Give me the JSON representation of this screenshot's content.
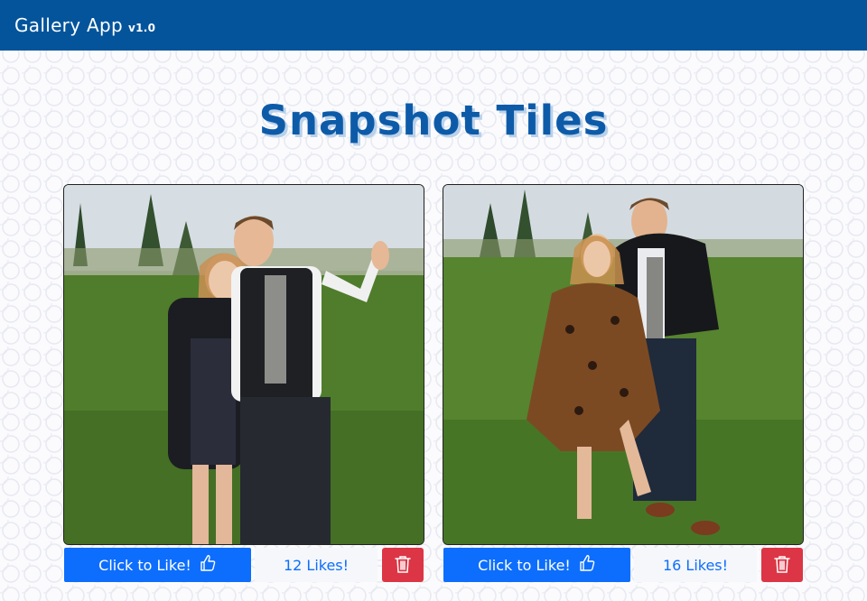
{
  "navbar": {
    "brand": "Gallery App",
    "version": "v1.0"
  },
  "page": {
    "title": "Snapshot Tiles"
  },
  "tiles": [
    {
      "like_label": "Click to Like!",
      "likes_text": "12 Likes!",
      "like_icon": "thumbs-up-icon",
      "delete_icon": "trash-icon"
    },
    {
      "like_label": "Click to Like!",
      "likes_text": "16 Likes!",
      "like_icon": "thumbs-up-icon",
      "delete_icon": "trash-icon"
    }
  ],
  "colors": {
    "navbar": "#04549c",
    "title": "#0d5ba8",
    "like_button": "#0d6efd",
    "delete_button": "#dc3545"
  }
}
